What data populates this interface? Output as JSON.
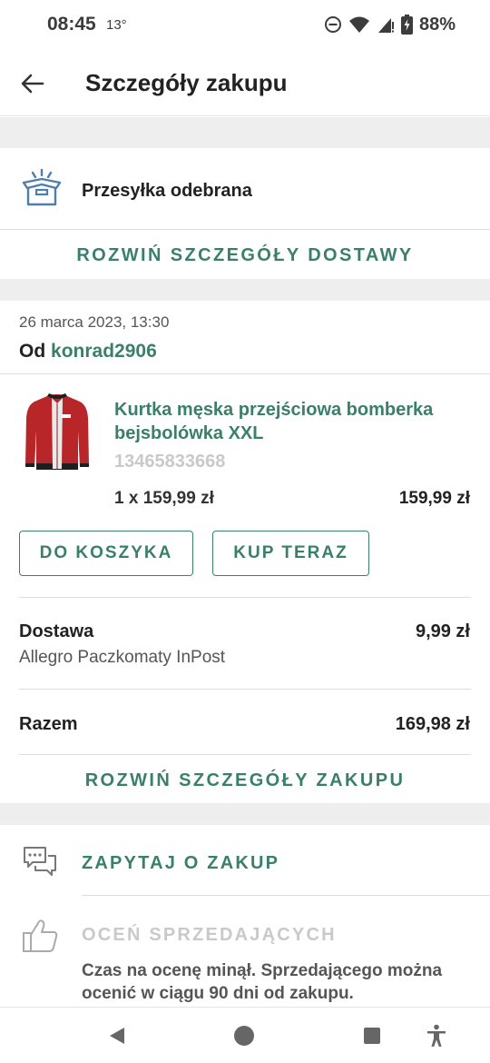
{
  "status_bar": {
    "time": "08:45",
    "temperature": "13°",
    "battery": "88%"
  },
  "header": {
    "title": "Szczegóły zakupu",
    "back_icon": "arrow-left-icon"
  },
  "shipment": {
    "status": "Przesyłka odebrana",
    "icon": "open-package-icon",
    "expand_label": "ROZWIŃ SZCZEGÓŁY DOSTAWY"
  },
  "purchase": {
    "date": "26 marca 2023, 13:30",
    "seller_prefix": "Od",
    "seller": "konrad2906"
  },
  "product": {
    "name": "Kurtka męska przejściowa bomberka bejsbolówka XXL",
    "id": "13465833668",
    "quantity_price": "1 x 159,99 zł",
    "total": "159,99 zł",
    "thumbnail": "red-bomber-jacket"
  },
  "buttons": {
    "add_to_cart": "DO KOSZYKA",
    "buy_now": "KUP TERAZ"
  },
  "summary": {
    "delivery_label": "Dostawa",
    "delivery_method": "Allegro Paczkomaty InPost",
    "delivery_price": "9,99 zł",
    "total_label": "Razem",
    "total_value": "169,98 zł",
    "expand_label": "ROZWIŃ SZCZEGÓŁY ZAKUPU"
  },
  "actions": {
    "ask_label": "ZAPYTAJ O ZAKUP",
    "ask_icon": "chat-bubbles-icon",
    "rate_label": "OCEŃ SPRZEDAJĄCYCH",
    "rate_icon": "thumbs-up-icon",
    "rate_note": "Czas na ocenę minął. Sprzedającego można ocenić w ciągu 90 dni od zakupu."
  },
  "colors": {
    "accent": "#3a7f6a",
    "disabled": "#c9c9c9",
    "background_gap": "#eeeeee"
  }
}
